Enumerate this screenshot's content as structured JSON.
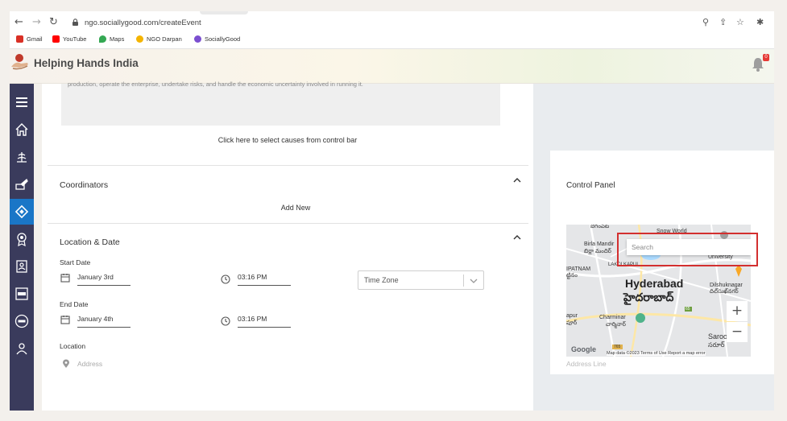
{
  "browser": {
    "url": "ngo.sociallygood.com/createEvent",
    "bookmarks": [
      {
        "label": "Gmail",
        "color": "#d93025"
      },
      {
        "label": "YouTube",
        "color": "#ff0000"
      },
      {
        "label": "Maps",
        "color": "#34a853"
      },
      {
        "label": "NGO Darpan",
        "color": "#f4b400"
      },
      {
        "label": "SociallyGood",
        "color": "#7b4fd0"
      }
    ]
  },
  "header": {
    "brand": "Helping Hands India",
    "notification_count": "0"
  },
  "sidebar": {
    "items": [
      {
        "icon": "menu-icon"
      },
      {
        "icon": "home-icon"
      },
      {
        "icon": "causes-icon"
      },
      {
        "icon": "projects-icon"
      },
      {
        "icon": "events-icon",
        "active": true
      },
      {
        "icon": "award-icon"
      },
      {
        "icon": "profile-icon"
      },
      {
        "icon": "ngo-icon"
      },
      {
        "icon": "csr-icon"
      },
      {
        "icon": "volunteers-icon"
      }
    ]
  },
  "form": {
    "description_fragment": "production, operate the enterprise, undertake risks, and handle the economic uncertainty involved in running it.",
    "causes_link": "Click here to select causes from control bar",
    "coordinators": {
      "title": "Coordinators",
      "add_new": "Add New"
    },
    "location_date": {
      "title": "Location & Date",
      "start_date_label": "Start Date",
      "start_date": "January 3rd",
      "start_time": "03:16 PM",
      "time_zone_placeholder": "Time Zone",
      "end_date_label": "End Date",
      "end_date": "January 4th",
      "end_time": "03:16 PM",
      "location_label": "Location",
      "address_placeholder": "Address"
    }
  },
  "control_panel": {
    "title": "Control Panel",
    "address_line_placeholder": "Address Line",
    "map": {
      "search_placeholder": "Search",
      "labels": {
        "telugu_top": "బేగంపేట",
        "birla": "Birla Mandir",
        "birla_telugu": "బిర్లా మందిర్",
        "snow": "Snow World",
        "university": "University",
        "patnam": "IPATNAM",
        "patnam_telugu": "ట్టినం",
        "lakdi": "LAKDI KAPUL",
        "city": "Hyderabad",
        "city_telugu": "హైదరాబాద్",
        "dilsukh": "Dilshuknagar",
        "dilsukh_telugu": "దిల్‌సుఖ్‌నగర్",
        "pur": "apur",
        "pur_telugu": "పూర్",
        "charminar": "Charminar",
        "charminar_telugu": "చార్మినార్",
        "saroor": "Saroor",
        "saroor_telugu": "సరూర్‌",
        "road_65": "65",
        "road_765": "765",
        "google": "Google",
        "footer": "Map data ©2023   Terms of Use   Report a map error"
      },
      "zoom_in": "+",
      "zoom_out": "−"
    }
  }
}
